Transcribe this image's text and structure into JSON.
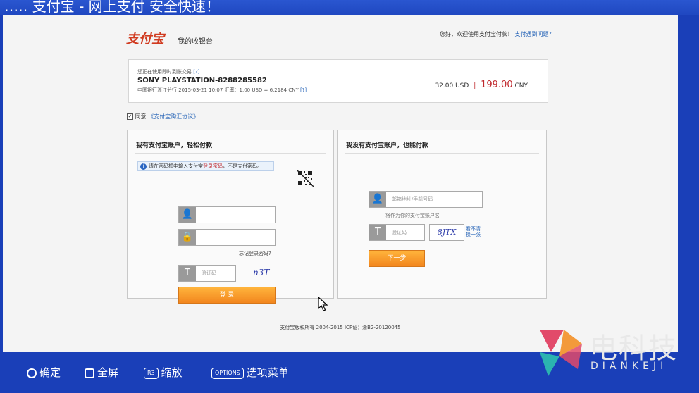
{
  "window_title": "‥… 支付宝 - 网上支付 安全快速！",
  "header": {
    "logo": "支付宝",
    "cashier": "我的收银台",
    "welcome": "您好，欢迎使用支付宝付款！",
    "help_link": "支付遇到问题?"
  },
  "order": {
    "line1": "您正在使用即时到账交易",
    "line1_q": "[?]",
    "merchant": "SONY PLAYSTATION-8288285582",
    "line3": "中国银行浙江分行 2015-03-21 10:07 汇率：1.00 USD = 6.2184 CNY",
    "line3_q": "[?]",
    "usd": "32.00 USD",
    "sep": "|",
    "cny_amount": "199.00",
    "cny_unit": "CNY"
  },
  "agree": {
    "checked": "✓",
    "label": "同意",
    "link": "《支付宝购汇协议》"
  },
  "left": {
    "title": "我有支付宝账户，轻松付款",
    "notice_pre": "请在密码框中输入支付宝",
    "notice_red": "登录密码",
    "notice_post": "，不是支付密码。",
    "forgot": "忘记登录密码?",
    "captcha_placeholder": "验证码",
    "captcha_text": "n3T",
    "login_button": "登 录"
  },
  "right": {
    "title": "我没有支付宝账户，也能付款",
    "email_placeholder": "邮箱地址/手机号码",
    "hint": "将作为你的支付宝账户名",
    "captcha_placeholder": "验证码",
    "captcha_text": "8JTX",
    "refresh_1": "看不清",
    "refresh_2": "换一张",
    "next_button": "下一步"
  },
  "footer": "支付宝版权所有 2004-2015 ICP证：浙B2-20120045",
  "bottom_bar": {
    "confirm": "确定",
    "fullscreen": "全屏",
    "r3": "R3",
    "zoom": "缩放",
    "options": "OPTIONS",
    "menu": "选项菜单"
  },
  "watermark": {
    "text": "电科技",
    "sub": "DIANKEJI"
  },
  "colors": {
    "desktop": "#1a3fb8",
    "accent_orange": "#f2861e",
    "price_red": "#c0282d",
    "link_blue": "#1f5fb5"
  }
}
